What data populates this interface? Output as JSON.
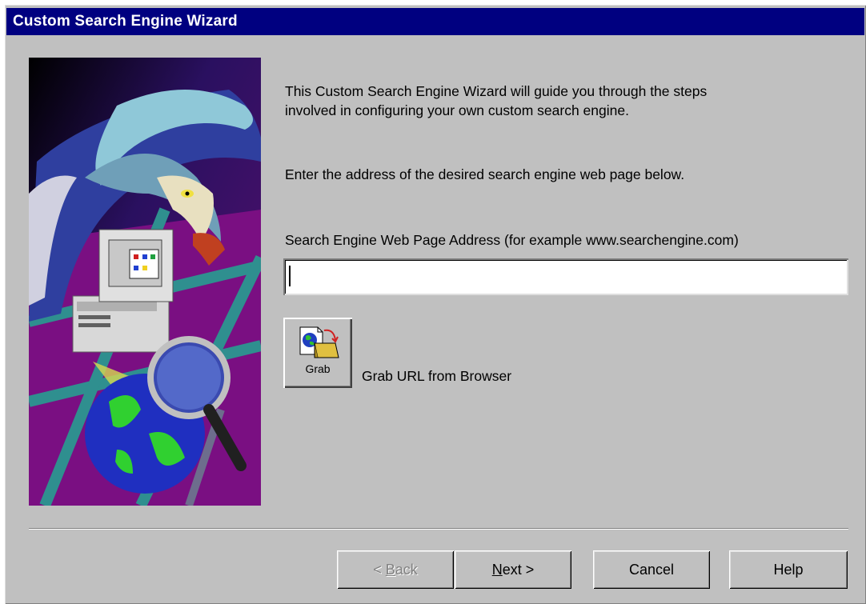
{
  "window": {
    "title": "Custom Search Engine Wizard"
  },
  "intro": {
    "line1": "This Custom Search Engine Wizard will guide you through the steps",
    "line2": "involved in configuring your own custom search engine.",
    "instruction": "Enter the address of the desired search engine web page below."
  },
  "address": {
    "label": "Search Engine Web Page Address (for example www.searchengine.com)",
    "value": ""
  },
  "grab": {
    "button_label": "Grab",
    "description": "Grab URL from Browser",
    "icon": "grab-url-icon"
  },
  "buttons": {
    "back_mnemonic": "B",
    "back_rest": "ack",
    "back_prefix": "< ",
    "next_mnemonic": "N",
    "next_rest": "ext >",
    "cancel": "Cancel",
    "help": "Help"
  },
  "colors": {
    "titlebar": "#000080",
    "face": "#c0c0c0"
  }
}
